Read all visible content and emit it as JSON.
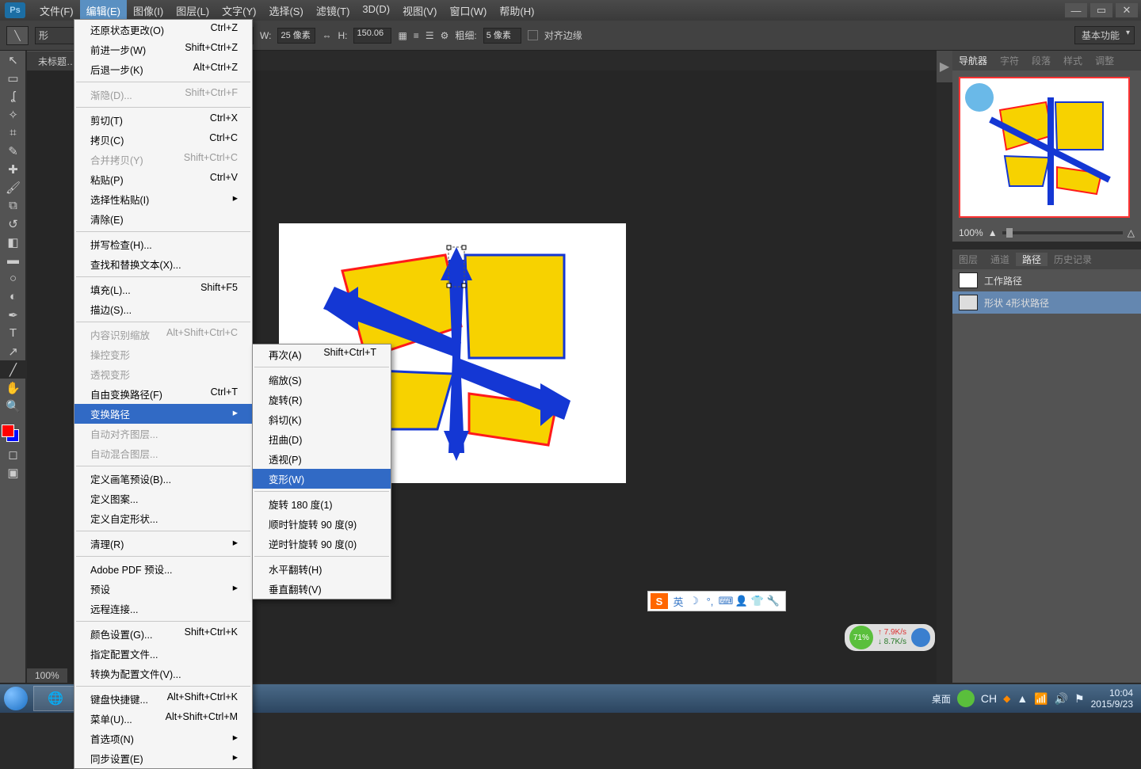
{
  "app": {
    "logo": "Ps"
  },
  "menubar": [
    "文件(F)",
    "编辑(E)",
    "图像(I)",
    "图层(L)",
    "文字(Y)",
    "选择(S)",
    "滤镜(T)",
    "3D(D)",
    "视图(V)",
    "窗口(W)",
    "帮助(H)"
  ],
  "active_menu_index": 1,
  "options": {
    "shape_prefix": "形",
    "w_label": "W:",
    "w_value": "25 像素",
    "h_label": "H:",
    "h_value": "150.06",
    "thick_label": "粗细:",
    "thick_value": "5 像素",
    "align_label": "对齐边缘",
    "workspace": "基本功能"
  },
  "doc_tab": "未标题…",
  "zoom_text": "100%",
  "edit_menu": [
    {
      "t": "row",
      "l": "还原状态更改(O)",
      "s": "Ctrl+Z"
    },
    {
      "t": "row",
      "l": "前进一步(W)",
      "s": "Shift+Ctrl+Z"
    },
    {
      "t": "row",
      "l": "后退一步(K)",
      "s": "Alt+Ctrl+Z"
    },
    {
      "t": "sep"
    },
    {
      "t": "row",
      "l": "渐隐(D)...",
      "s": "Shift+Ctrl+F",
      "d": true
    },
    {
      "t": "sep"
    },
    {
      "t": "row",
      "l": "剪切(T)",
      "s": "Ctrl+X"
    },
    {
      "t": "row",
      "l": "拷贝(C)",
      "s": "Ctrl+C"
    },
    {
      "t": "row",
      "l": "合并拷贝(Y)",
      "s": "Shift+Ctrl+C",
      "d": true
    },
    {
      "t": "row",
      "l": "粘贴(P)",
      "s": "Ctrl+V"
    },
    {
      "t": "row",
      "l": "选择性粘贴(I)",
      "sub": true
    },
    {
      "t": "row",
      "l": "清除(E)"
    },
    {
      "t": "sep"
    },
    {
      "t": "row",
      "l": "拼写检查(H)..."
    },
    {
      "t": "row",
      "l": "查找和替换文本(X)..."
    },
    {
      "t": "sep"
    },
    {
      "t": "row",
      "l": "填充(L)...",
      "s": "Shift+F5"
    },
    {
      "t": "row",
      "l": "描边(S)..."
    },
    {
      "t": "sep"
    },
    {
      "t": "row",
      "l": "内容识别缩放",
      "s": "Alt+Shift+Ctrl+C",
      "d": true
    },
    {
      "t": "row",
      "l": "操控变形",
      "d": true
    },
    {
      "t": "row",
      "l": "透视变形",
      "d": true
    },
    {
      "t": "row",
      "l": "自由变换路径(F)",
      "s": "Ctrl+T"
    },
    {
      "t": "row",
      "l": "变换路径",
      "sub": true,
      "hl": true
    },
    {
      "t": "row",
      "l": "自动对齐图层...",
      "d": true
    },
    {
      "t": "row",
      "l": "自动混合图层...",
      "d": true
    },
    {
      "t": "sep"
    },
    {
      "t": "row",
      "l": "定义画笔预设(B)..."
    },
    {
      "t": "row",
      "l": "定义图案..."
    },
    {
      "t": "row",
      "l": "定义自定形状..."
    },
    {
      "t": "sep"
    },
    {
      "t": "row",
      "l": "清理(R)",
      "sub": true
    },
    {
      "t": "sep"
    },
    {
      "t": "row",
      "l": "Adobe PDF 预设..."
    },
    {
      "t": "row",
      "l": "预设",
      "sub": true
    },
    {
      "t": "row",
      "l": "远程连接..."
    },
    {
      "t": "sep"
    },
    {
      "t": "row",
      "l": "颜色设置(G)...",
      "s": "Shift+Ctrl+K"
    },
    {
      "t": "row",
      "l": "指定配置文件..."
    },
    {
      "t": "row",
      "l": "转换为配置文件(V)..."
    },
    {
      "t": "sep"
    },
    {
      "t": "row",
      "l": "键盘快捷键...",
      "s": "Alt+Shift+Ctrl+K"
    },
    {
      "t": "row",
      "l": "菜单(U)...",
      "s": "Alt+Shift+Ctrl+M"
    },
    {
      "t": "row",
      "l": "首选项(N)",
      "sub": true
    },
    {
      "t": "row",
      "l": "同步设置(E)",
      "sub": true
    }
  ],
  "transform_submenu": [
    {
      "t": "row",
      "l": "再次(A)",
      "s": "Shift+Ctrl+T"
    },
    {
      "t": "sep"
    },
    {
      "t": "row",
      "l": "缩放(S)"
    },
    {
      "t": "row",
      "l": "旋转(R)"
    },
    {
      "t": "row",
      "l": "斜切(K)"
    },
    {
      "t": "row",
      "l": "扭曲(D)"
    },
    {
      "t": "row",
      "l": "透视(P)"
    },
    {
      "t": "row",
      "l": "变形(W)",
      "hl": true
    },
    {
      "t": "sep"
    },
    {
      "t": "row",
      "l": "旋转 180 度(1)"
    },
    {
      "t": "row",
      "l": "顺时针旋转 90 度(9)"
    },
    {
      "t": "row",
      "l": "逆时针旋转 90 度(0)"
    },
    {
      "t": "sep"
    },
    {
      "t": "row",
      "l": "水平翻转(H)"
    },
    {
      "t": "row",
      "l": "垂直翻转(V)"
    }
  ],
  "panel_top_tabs": [
    "导航器",
    "字符",
    "段落",
    "样式",
    "调整"
  ],
  "nav_zoom": "100%",
  "layer_tabs": [
    "图层",
    "通道",
    "路径",
    "历史记录"
  ],
  "paths": [
    {
      "name": "工作路径",
      "sel": false
    },
    {
      "name": "形状 4形状路径",
      "sel": true
    }
  ],
  "sougou_lang": "英",
  "net": {
    "pct": "71%",
    "up": "7.9K/s",
    "down": "8.7K/s"
  },
  "tray": {
    "desktop": "桌面",
    "ime": "CH",
    "time": "10:04",
    "date": "2015/9/23"
  }
}
